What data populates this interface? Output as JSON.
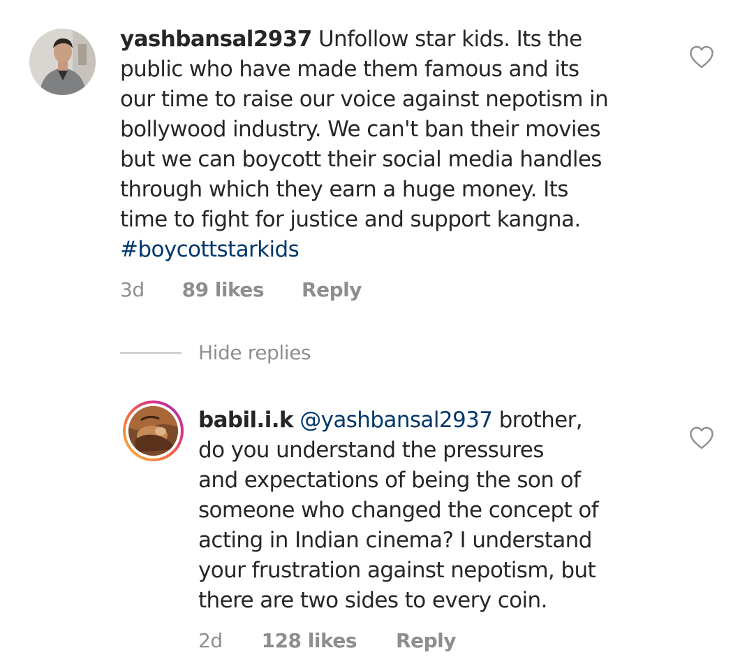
{
  "comments": [
    {
      "username": "yashbansal2937",
      "text": "Unfollow star kids. Its the\npublic who have made them famous and its\nour time to raise our voice against nepotism in\nbollywood industry. We can't ban their movies\nbut we can boycott their social media handles\nthrough which they earn a huge money. Its\ntime to fight for justice and support kangna.\n",
      "hashtag": "#boycottstarkids",
      "time": "3d",
      "likes": "89 likes",
      "reply_label": "Reply",
      "icon": "heart-outline-icon"
    }
  ],
  "hide_replies_label": "Hide replies",
  "replies": [
    {
      "username": "babil.i.k",
      "mention": "@yashbansal2937",
      "text": "brother,\ndo you understand the pressures\nand expectations of being the son of\nsomeone who changed the concept of\nacting in Indian cinema? I understand\nyour frustration against nepotism, but\nthere are two sides to every coin.",
      "time": "2d",
      "likes": "128 likes",
      "reply_label": "Reply",
      "icon": "heart-outline-icon"
    }
  ],
  "colors": {
    "text": "#262626",
    "meta": "#8e8e8e",
    "link": "#00376b",
    "story_ring": [
      "#f9c23c",
      "#f06543",
      "#d62f8d",
      "#8a3ab9"
    ]
  }
}
